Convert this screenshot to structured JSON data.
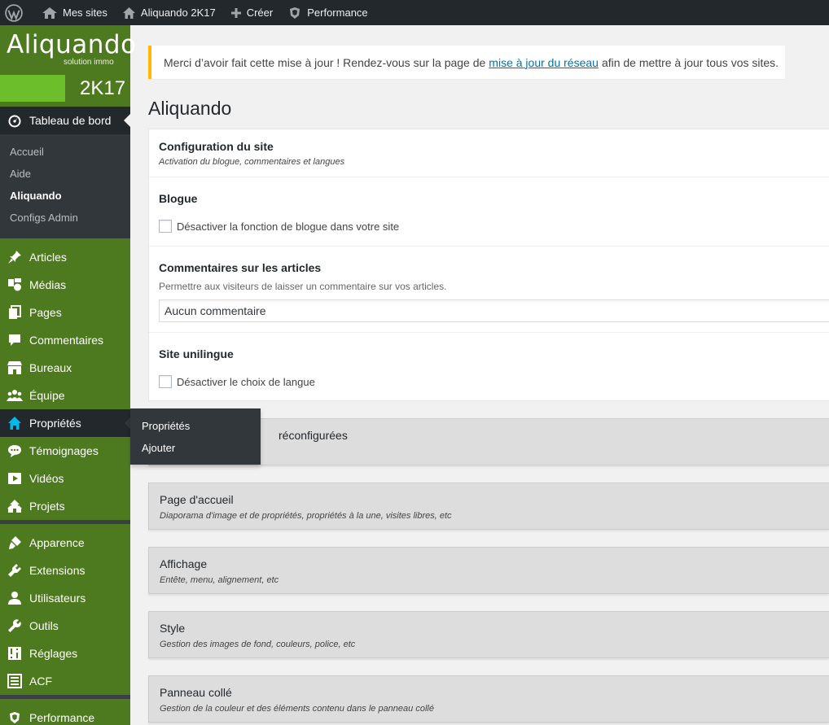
{
  "adminbar": {
    "wp_icon": "wordpress-logo-icon",
    "items": [
      {
        "label": "Mes sites",
        "icon": "my-sites-icon"
      },
      {
        "label": "Aliquando 2K17",
        "icon": "home-icon"
      },
      {
        "label": "Créer",
        "icon": "plus-icon"
      },
      {
        "label": "Performance",
        "icon": "w3tc-icon"
      }
    ]
  },
  "logo": {
    "main": "Aliquando",
    "sub": "solution immo",
    "year": "2K17",
    "accent": "#6cbf2b"
  },
  "sidebar": {
    "current": {
      "label": "Tableau de bord",
      "icon": "dashboard-icon"
    },
    "current_sub": [
      "Accueil",
      "Aide",
      "Aliquando",
      "Configs Admin"
    ],
    "group1": [
      {
        "label": "Articles",
        "icon": "pin-icon"
      },
      {
        "label": "Médias",
        "icon": "media-icon"
      },
      {
        "label": "Pages",
        "icon": "pages-icon"
      },
      {
        "label": "Commentaires",
        "icon": "comment-icon"
      },
      {
        "label": "Bureaux",
        "icon": "store-icon"
      },
      {
        "label": "Équipe",
        "icon": "groups-icon"
      },
      {
        "label": "Propriétés",
        "icon": "home-icon"
      },
      {
        "label": "Témoignages",
        "icon": "testimonial-icon"
      },
      {
        "label": "Vidéos",
        "icon": "video-icon"
      },
      {
        "label": "Projets",
        "icon": "admin-multisite-icon"
      }
    ],
    "group2": [
      {
        "label": "Apparence",
        "icon": "brush-icon"
      },
      {
        "label": "Extensions",
        "icon": "plugin-icon"
      },
      {
        "label": "Utilisateurs",
        "icon": "user-icon"
      },
      {
        "label": "Outils",
        "icon": "wrench-icon"
      },
      {
        "label": "Réglages",
        "icon": "settings-icon"
      },
      {
        "label": "ACF",
        "icon": "acf-icon"
      }
    ],
    "group3": [
      {
        "label": "Performance",
        "icon": "w3tc-icon"
      }
    ],
    "flyout": [
      "Propriétés",
      "Ajouter"
    ]
  },
  "notice": {
    "before": "Merci d’avoir fait cette mise à jour ! Rendez-vous sur la page de",
    "link": "mise à jour du réseau",
    "after": "afin de mettre à jour tous vos sites."
  },
  "page_title": "Aliquando",
  "panel": {
    "config": {
      "title": "Configuration du site",
      "desc": "Activation du blogue, commentaires et langues"
    },
    "blogue": {
      "title": "Blogue",
      "checkbox": "Désactiver la fonction de blogue dans votre site"
    },
    "comments": {
      "title": "Commentaires sur les articles",
      "desc": "Permettre aux visiteurs de laisser un commentaire sur vos articles.",
      "select_value": "Aucun commentaire"
    },
    "lang": {
      "title": "Site unilingue",
      "checkbox": "Désactiver le choix de langue"
    }
  },
  "boxes": [
    {
      "title": "réconfigurées",
      "desc": ""
    },
    {
      "title": "Page d'accueil",
      "desc": "Diaporama d'image et de propriétés, propriétés à la une, visites libres, etc"
    },
    {
      "title": "Affichage",
      "desc": "Entête, menu, alignement, etc"
    },
    {
      "title": "Style",
      "desc": "Gestion des images de fond, couleurs, police, etc"
    },
    {
      "title": "Panneau collé",
      "desc": "Gestion de la couleur et des éléments contenu dans le panneau collé"
    }
  ]
}
